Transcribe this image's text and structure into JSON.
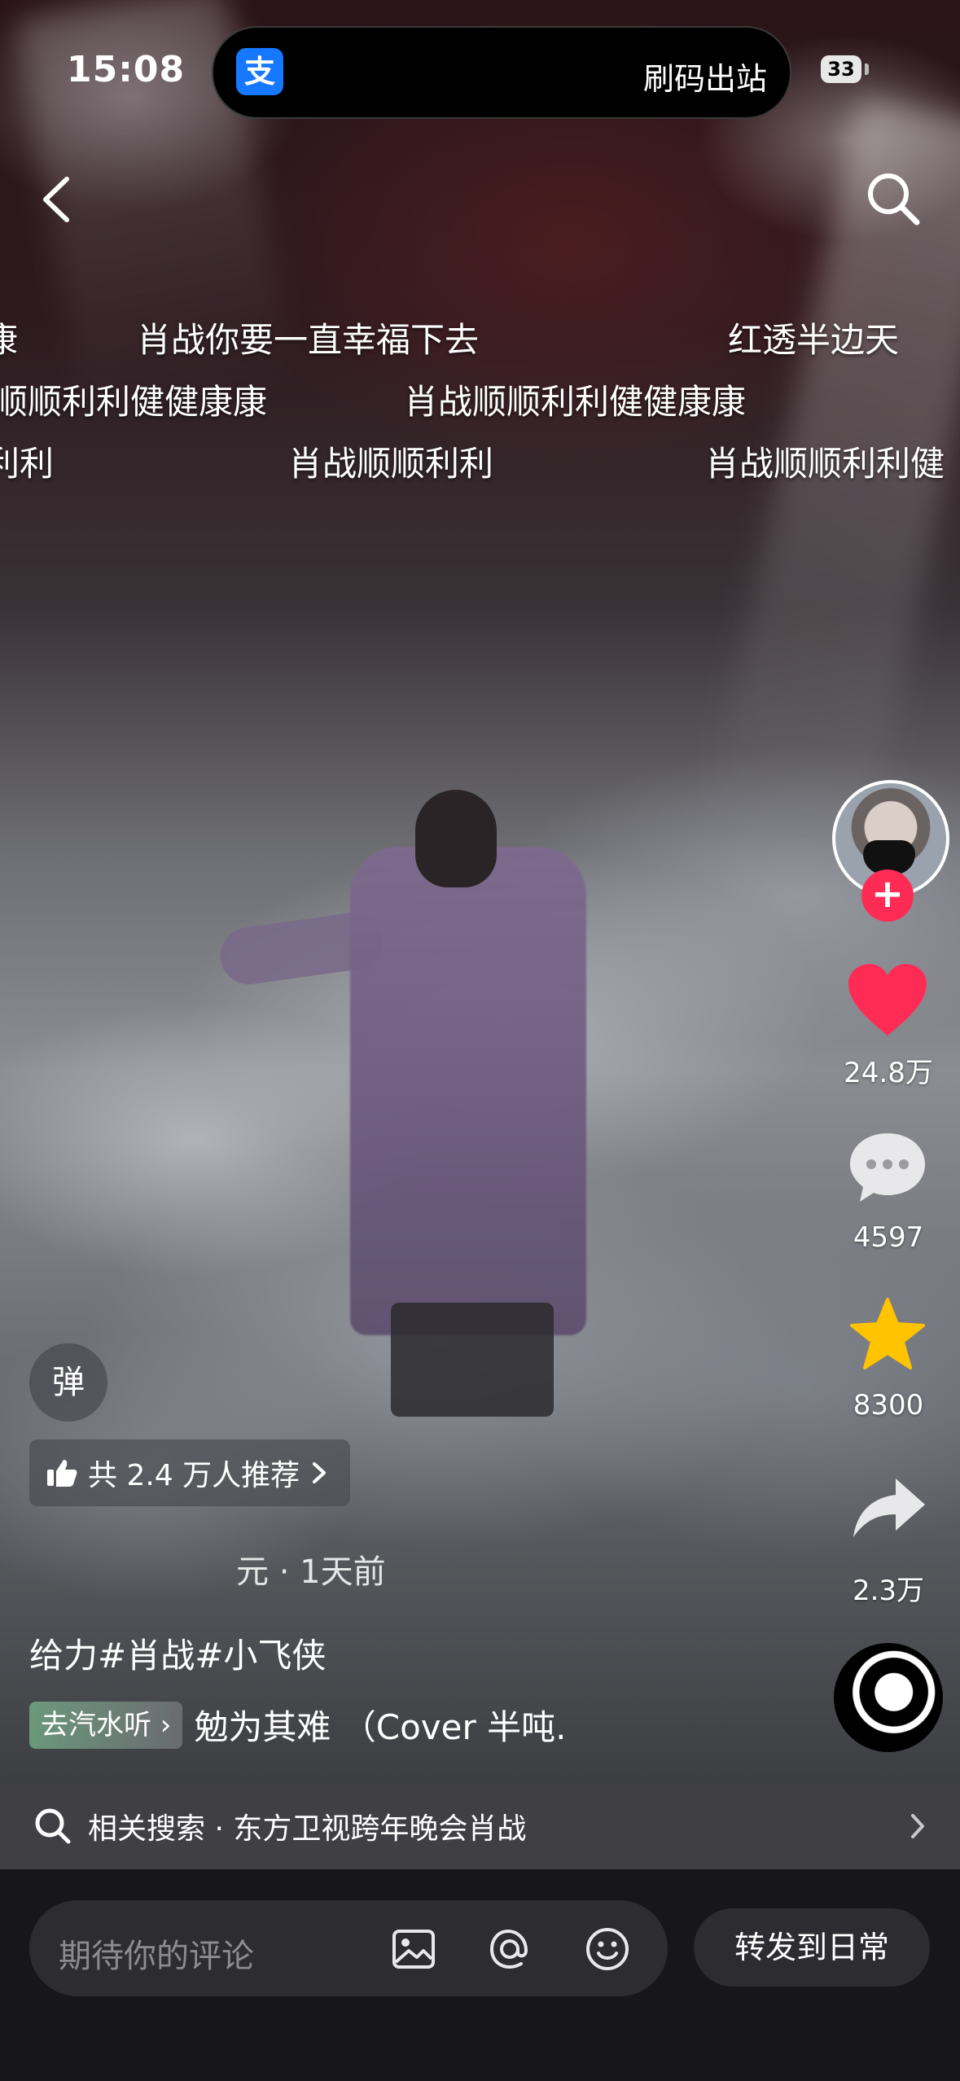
{
  "status_bar": {
    "time": "15:08",
    "island_app_icon": "支",
    "island_text": "刷码出站",
    "battery": "33"
  },
  "nav": {
    "back_icon": "chevron-left-icon",
    "search_icon": "search-icon"
  },
  "danmaku": [
    "康",
    "肖战你要一直幸福下去",
    "红透半边天",
    "顺顺利利健健康康",
    "肖战顺顺利利健健康康",
    "利利",
    "肖战顺顺利利",
    "肖战顺顺利利健"
  ],
  "actions": {
    "like_count": "24.8万",
    "comment_count": "4597",
    "favorite_count": "8300",
    "share_count": "2.3万",
    "follow_symbol": "+",
    "like_color": "#fe2c55",
    "favorite_color": "#ffc300"
  },
  "overlay": {
    "danmaku_toggle": "弹",
    "recommend_text": "共 2.4 万人推荐",
    "author_time": "元 · 1天前",
    "caption": "给力#肖战#小飞侠",
    "music_tag": "去汽水听",
    "music_title": "勉为其难 （Cover 半吨."
  },
  "related_search": {
    "text": "相关搜索 · 东方卫视跨年晚会肖战"
  },
  "comment_bar": {
    "placeholder": "期待你的评论",
    "forward_label": "转发到日常"
  }
}
